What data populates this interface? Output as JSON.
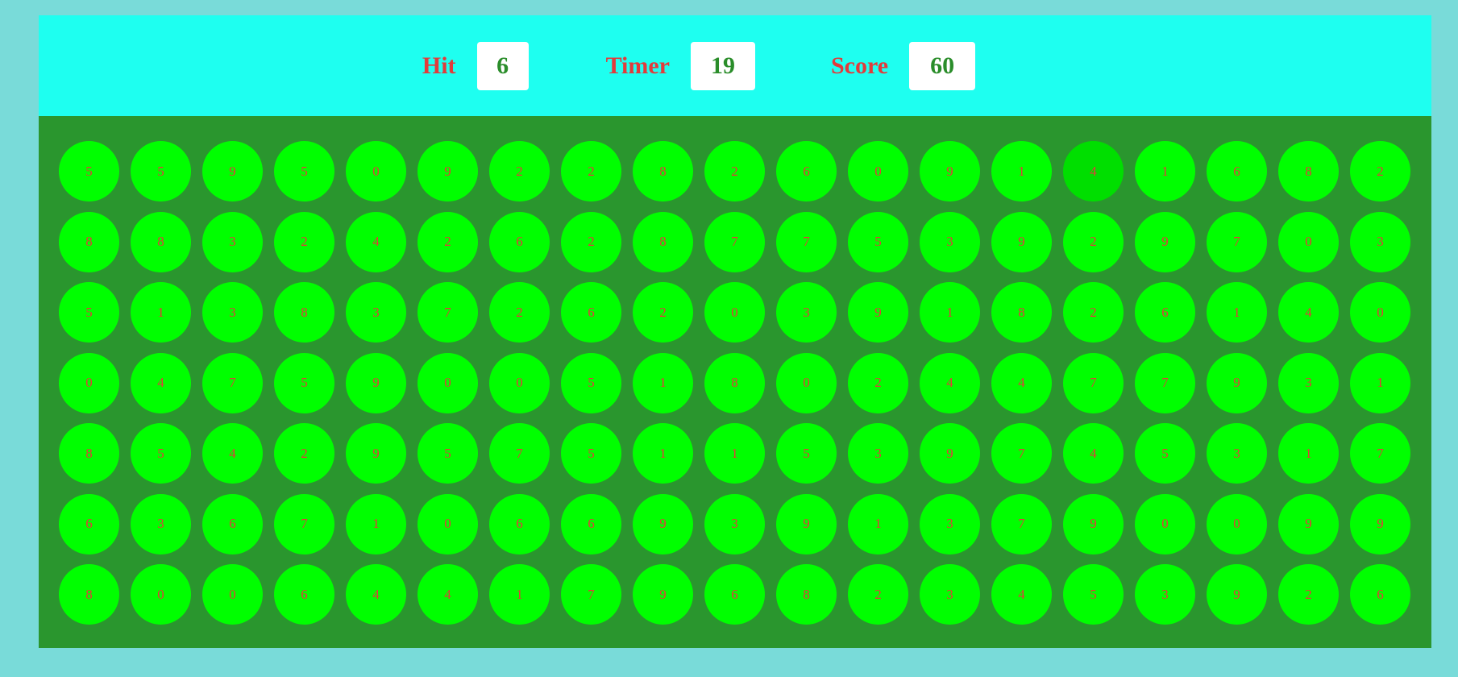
{
  "panel": {
    "hit_label": "Hit",
    "hit_value": "6",
    "timer_label": "Timer",
    "timer_value": "19",
    "score_label": "Score",
    "score_value": "60"
  },
  "board": {
    "rows": [
      [
        "5",
        "5",
        "9",
        "5",
        "0",
        "9",
        "2",
        "2",
        "8",
        "2",
        "6",
        "0",
        "9",
        "1",
        "4",
        "1",
        "6",
        "8",
        "2"
      ],
      [
        "8",
        "8",
        "3",
        "2",
        "4",
        "2",
        "6",
        "2",
        "8",
        "7",
        "7",
        "5",
        "3",
        "9",
        "2",
        "9",
        "7",
        "0",
        "3"
      ],
      [
        "5",
        "1",
        "3",
        "8",
        "3",
        "7",
        "2",
        "6",
        "2",
        "0",
        "3",
        "9",
        "1",
        "8",
        "2",
        "6",
        "1",
        "4",
        "0"
      ],
      [
        "0",
        "4",
        "7",
        "5",
        "9",
        "0",
        "0",
        "5",
        "1",
        "8",
        "0",
        "2",
        "4",
        "4",
        "7",
        "7",
        "9",
        "3",
        "1"
      ],
      [
        "8",
        "5",
        "4",
        "2",
        "9",
        "5",
        "7",
        "5",
        "1",
        "1",
        "5",
        "3",
        "9",
        "7",
        "4",
        "5",
        "3",
        "1",
        "7"
      ],
      [
        "6",
        "3",
        "6",
        "7",
        "1",
        "0",
        "6",
        "6",
        "9",
        "3",
        "9",
        "1",
        "3",
        "7",
        "9",
        "0",
        "0",
        "9",
        "9"
      ],
      [
        "8",
        "0",
        "0",
        "6",
        "4",
        "4",
        "1",
        "7",
        "9",
        "6",
        "8",
        "2",
        "3",
        "4",
        "5",
        "3",
        "9",
        "2",
        "6"
      ]
    ],
    "hovered": {
      "row": 0,
      "col": 14
    }
  },
  "colors": {
    "page_background": "#79dbd9",
    "panel_top": "#1efff0",
    "panel_bottom": "#2a962e",
    "bubble": "#00ff00",
    "bubble_hover": "#00df00",
    "label_text": "#e23b3b",
    "value_text": "#2a8d2a"
  }
}
